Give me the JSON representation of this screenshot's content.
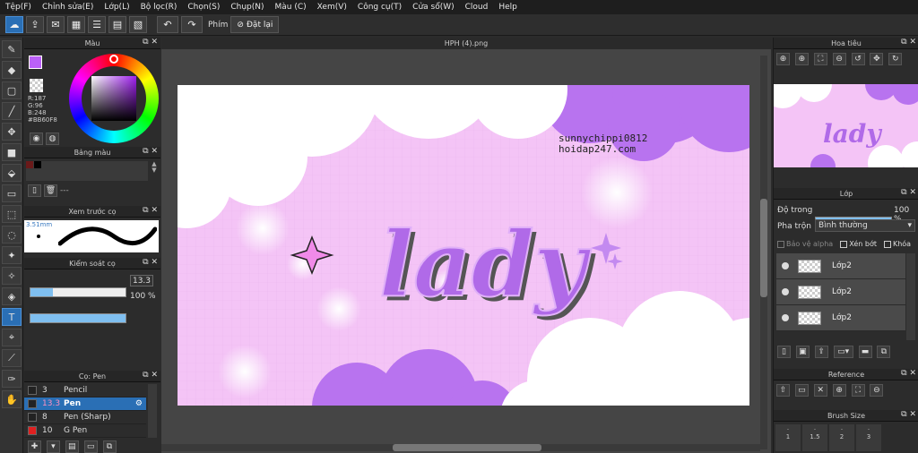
{
  "menu": [
    "Tệp(F)",
    "Chỉnh sửa(E)",
    "Lớp(L)",
    "Bộ lọc(R)",
    "Chọn(S)",
    "Chụp(N)",
    "Màu (C)",
    "Xem(V)",
    "Công cụ(T)",
    "Cửa sổ(W)",
    "Cloud",
    "Help"
  ],
  "toolbar": {
    "label": "Phím",
    "reset_label": "Đặt lại"
  },
  "color_panel": {
    "title": "Màu",
    "r": "R:187",
    "g": "G:96",
    "b": "B:248",
    "hex": "#BB60F8",
    "accent": "#BB60F8"
  },
  "palette_panel": {
    "title": "Bảng màu",
    "placeholder": "---"
  },
  "preview_panel": {
    "title": "Xem trước cọ",
    "size": "3.51mm"
  },
  "brush_control": {
    "title": "Kiểm soát cọ",
    "size_value": "13.3",
    "opacity_value": "100 %",
    "size_fraction": 0.24,
    "opacity_fraction": 1.0
  },
  "brush_panel": {
    "title": "Cọ: Pen",
    "items": [
      {
        "num": "3",
        "name": "Pencil",
        "color": "#222222"
      },
      {
        "num": "13.3",
        "name": "Pen",
        "color": "#222222",
        "selected": true
      },
      {
        "num": "8",
        "name": "Pen (Sharp)",
        "color": "#222222"
      },
      {
        "num": "10",
        "name": "G Pen",
        "color": "#e02020"
      }
    ]
  },
  "document": {
    "tab": "HPH (4).png",
    "watermark_line1": "sunnychippi0812",
    "watermark_line2": "hoidap247.com",
    "art_text": "lady"
  },
  "navigator_panel": {
    "title": "Hoa tiêu"
  },
  "layer_panel": {
    "title": "Lớp",
    "opacity_label": "Độ trong",
    "opacity_value": "100 %",
    "blend_label": "Pha trộn",
    "blend_value": "Bình thường",
    "protect_alpha": "Bảo vệ alpha",
    "clip": "Xén bớt",
    "lock": "Khóa",
    "layers": [
      {
        "name": "Lớp2"
      },
      {
        "name": "Lớp2"
      },
      {
        "name": "Lớp2"
      }
    ]
  },
  "reference_panel": {
    "title": "Reference"
  },
  "brush_size_panel": {
    "title": "Brush Size",
    "sizes": [
      "1",
      "1.5",
      "2",
      "3"
    ]
  }
}
